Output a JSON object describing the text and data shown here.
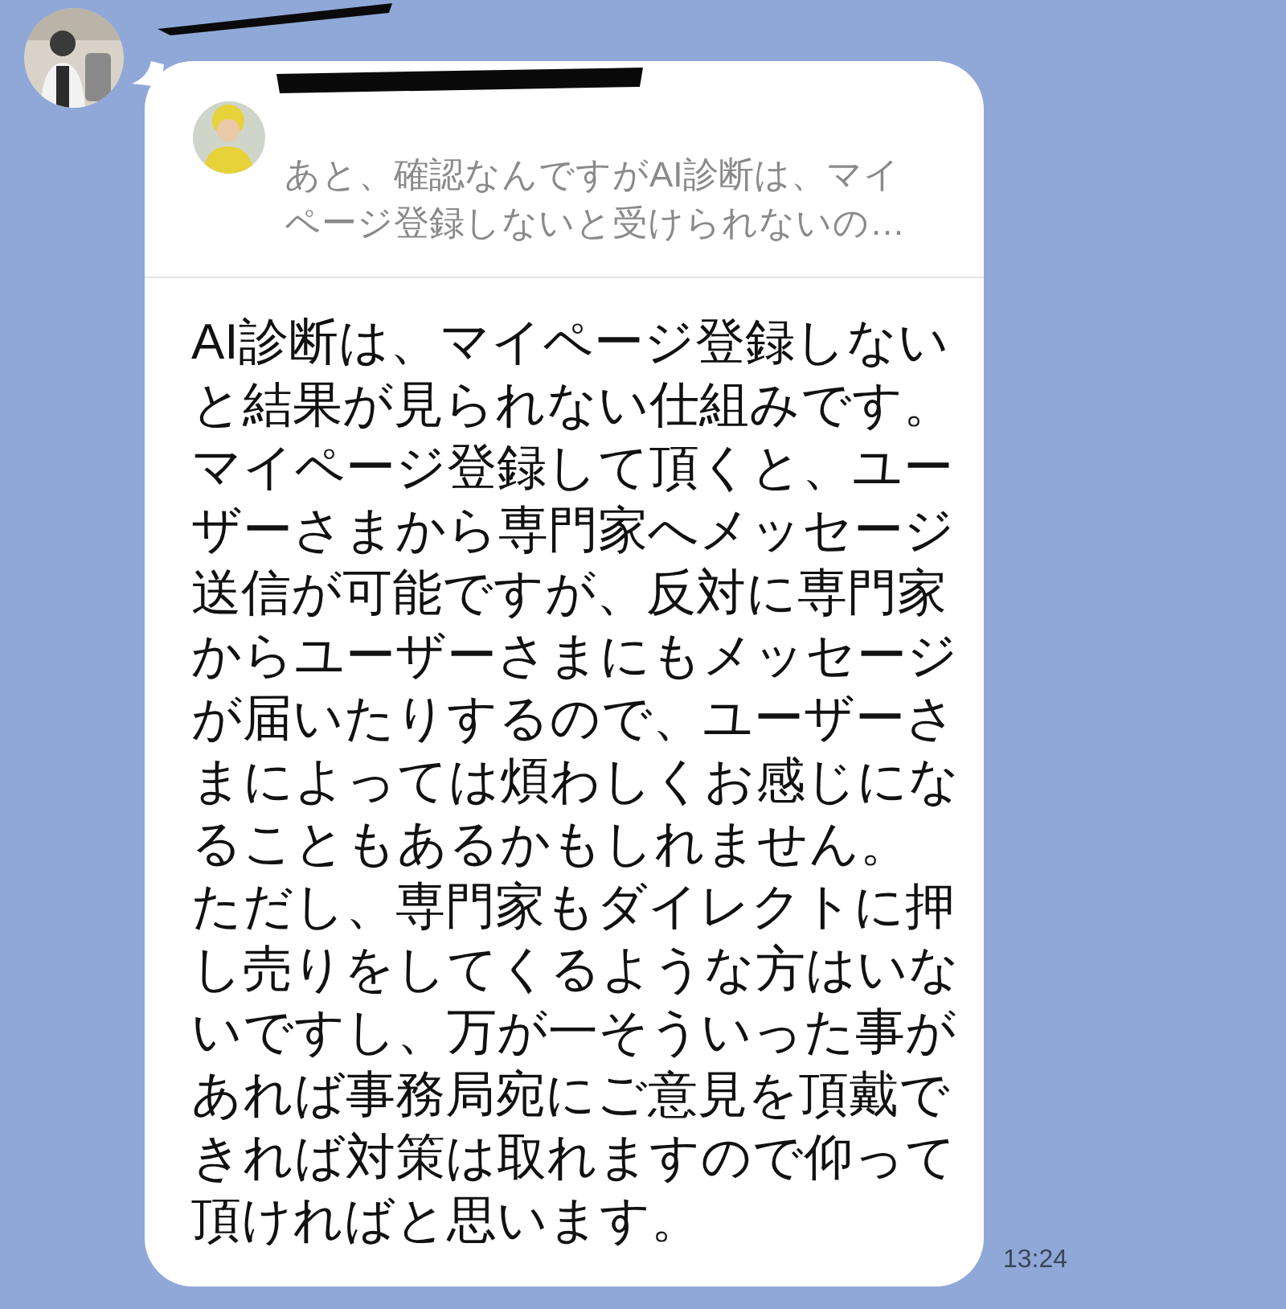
{
  "message": {
    "quote": {
      "text": "あと、確認なんですがAI診断は、マイページ登録しないと受けられないの…"
    },
    "paragraphs": [
      "AI診断は、マイページ登録しないと結果が見られない仕組みです。",
      "マイページ登録して頂くと、ユーザーさまから専門家へメッセージ送信が可能ですが、反対に専門家からユーザーさまにもメッセージが届いたりするので、ユーザーさまによっては煩わしくお感じになることもあるかもしれません。",
      "ただし、専門家もダイレクトに押し売りをしてくるような方はいないですし、万が一そういった事があれば事務局宛にご意見を頂戴できれば対策は取れますので仰って頂ければと思います。"
    ],
    "time": "13:24"
  }
}
